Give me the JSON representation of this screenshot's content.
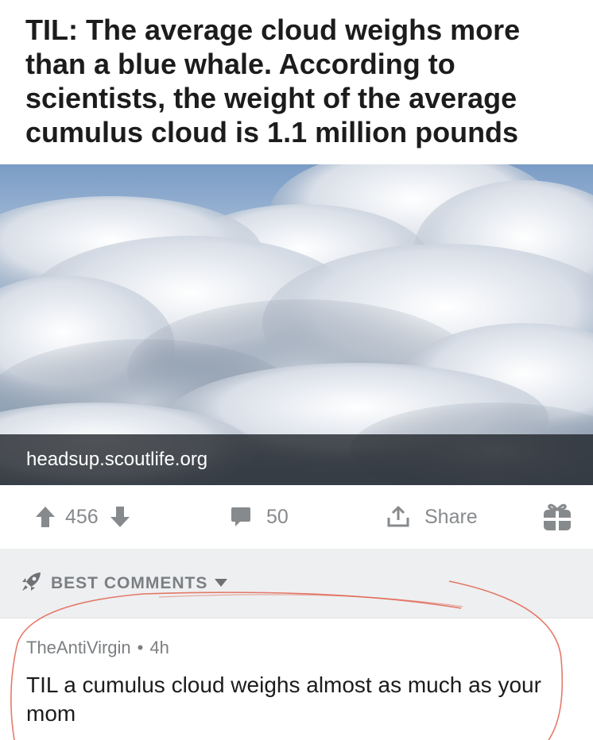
{
  "post": {
    "title": "TIL: The average cloud weighs more than a blue whale. According to scientists, the weight of the average cumulus cloud is 1.1 million pounds",
    "link_domain": "headsup.scoutlife.org",
    "image_subject": "cumulus clouds from above"
  },
  "actions": {
    "upvote_count": "456",
    "comment_count": "50",
    "share_label": "Share",
    "icons": [
      "upvote-arrow-icon",
      "downvote-arrow-icon",
      "comment-bubble-icon",
      "share-icon",
      "gift-icon"
    ]
  },
  "comments_header": {
    "sort_label": "BEST COMMENTS",
    "icons": [
      "rocket-icon",
      "caret-down-icon"
    ]
  },
  "comment": {
    "author": "TheAntiVirgin",
    "separator": "•",
    "age": "4h",
    "body": "TIL a cumulus cloud weighs almost as much as your mom"
  },
  "colors": {
    "muted_gray": "#878a8c",
    "sort_bar_bg": "#eeeff1",
    "annotation_red": "#e0634f"
  }
}
